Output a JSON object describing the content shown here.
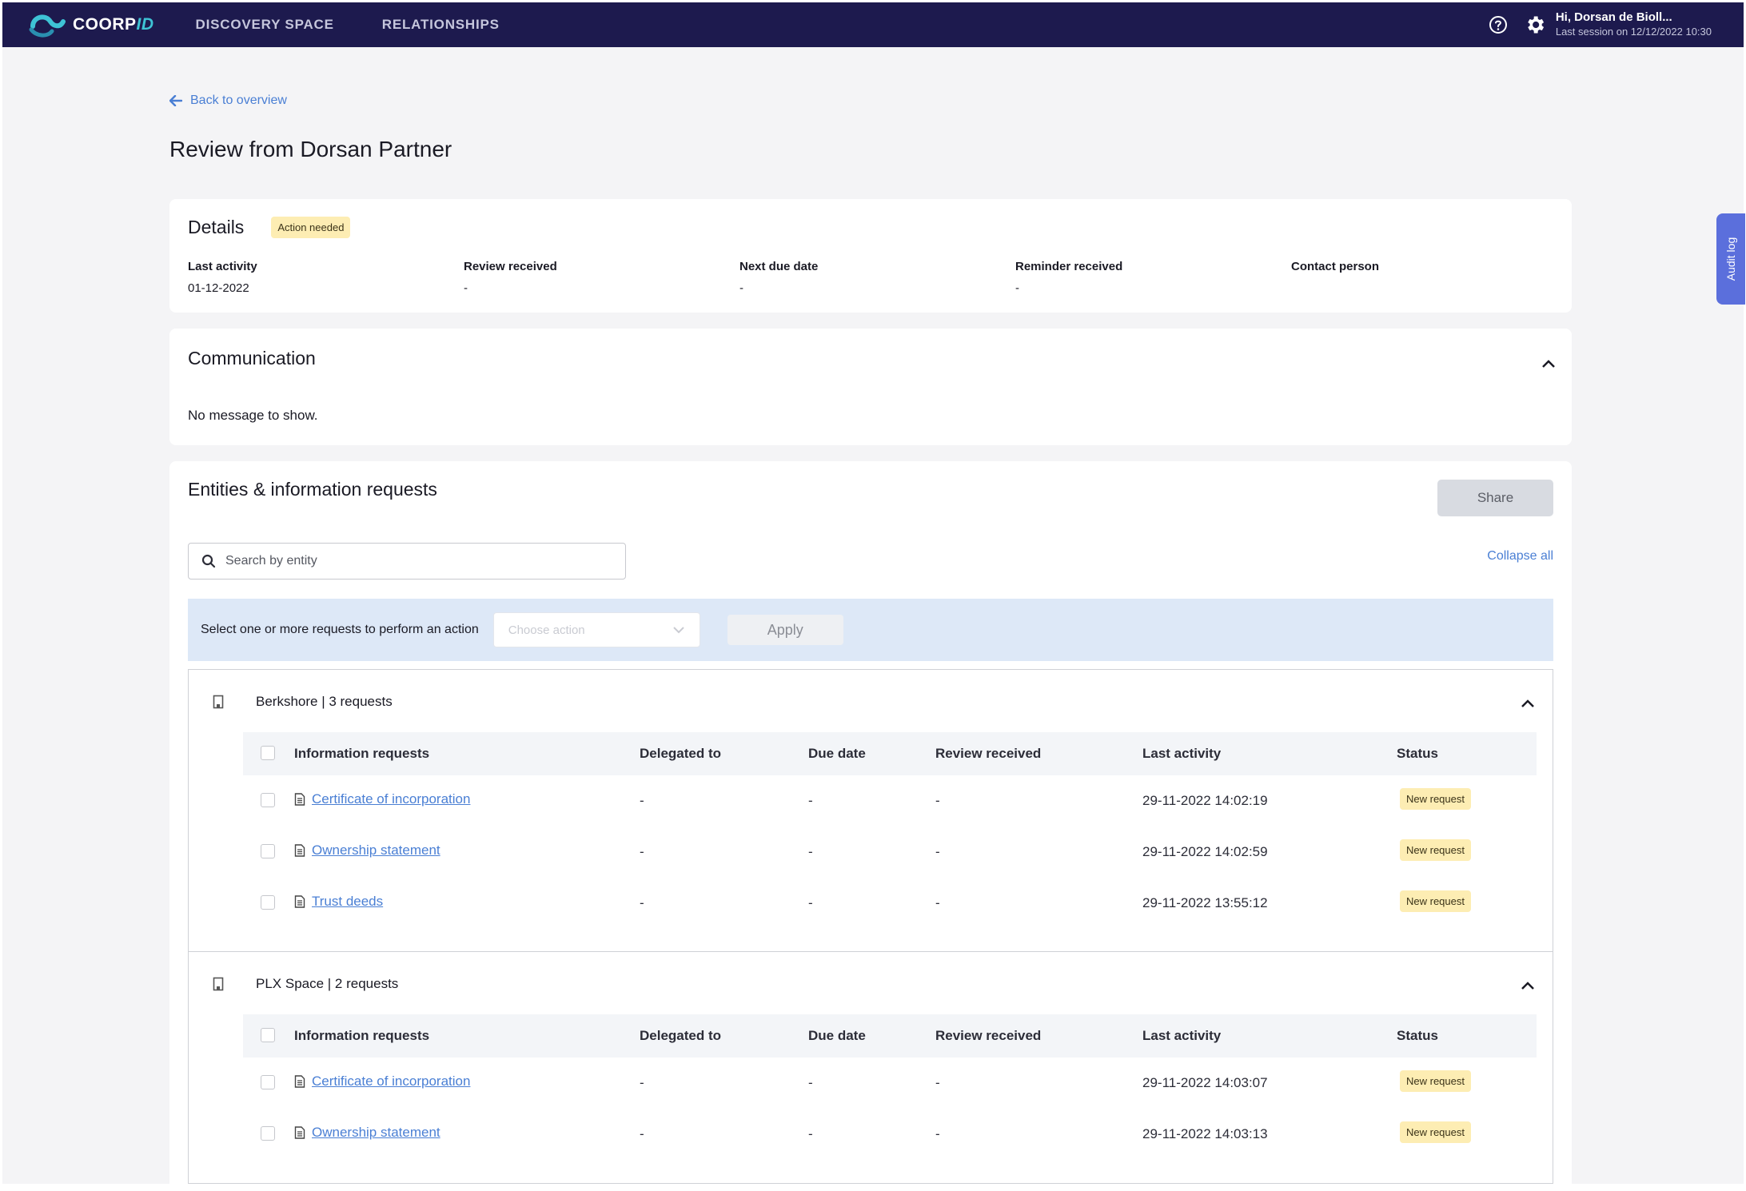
{
  "header": {
    "logo_text": "COORP",
    "logo_text_accent": "ID",
    "nav": [
      "DISCOVERY SPACE",
      "RELATIONSHIPS"
    ],
    "user_greeting": "Hi, Dorsan de Bioll...",
    "last_session": "Last session on  12/12/2022 10:30"
  },
  "back_link": "Back to overview",
  "page_title": "Review from Dorsan Partner",
  "details": {
    "title": "Details",
    "badge": "Action needed",
    "fields": [
      {
        "label": "Last activity",
        "value": "01-12-2022"
      },
      {
        "label": "Review received",
        "value": "-"
      },
      {
        "label": "Next due date",
        "value": "-"
      },
      {
        "label": "Reminder received",
        "value": "-"
      },
      {
        "label": "Contact person",
        "value": ""
      }
    ]
  },
  "communication": {
    "title": "Communication",
    "empty_message": "No message to show."
  },
  "entities": {
    "title": "Entities & information requests",
    "share_label": "Share",
    "search_placeholder": "Search by entity",
    "collapse_all": "Collapse all",
    "action_bar_label": "Select one or more requests to perform an action",
    "choose_action_placeholder": "Choose action",
    "apply_label": "Apply",
    "columns": [
      "Information requests",
      "Delegated to",
      "Due date",
      "Review received",
      "Last activity",
      "Status"
    ],
    "groups": [
      {
        "title": "Berkshore | 3 requests",
        "rows": [
          {
            "name": "Certificate of incorporation",
            "delegated": "-",
            "due": "-",
            "review": "-",
            "last_activity": "29-11-2022 14:02:19",
            "status": "New request"
          },
          {
            "name": "Ownership statement",
            "delegated": "-",
            "due": "-",
            "review": "-",
            "last_activity": "29-11-2022 14:02:59",
            "status": "New request"
          },
          {
            "name": "Trust deeds",
            "delegated": "-",
            "due": "-",
            "review": "-",
            "last_activity": "29-11-2022 13:55:12",
            "status": "New request"
          }
        ]
      },
      {
        "title": "PLX Space | 2 requests",
        "rows": [
          {
            "name": "Certificate of incorporation",
            "delegated": "-",
            "due": "-",
            "review": "-",
            "last_activity": "29-11-2022 14:03:07",
            "status": "New request"
          },
          {
            "name": "Ownership statement",
            "delegated": "-",
            "due": "-",
            "review": "-",
            "last_activity": "29-11-2022 14:03:13",
            "status": "New request"
          }
        ]
      }
    ]
  },
  "audit_log_label": "Audit log",
  "colors": {
    "header_bg": "#1d1a4e",
    "accent": "#4a7fd4",
    "badge_bg": "#fdedb3",
    "action_bar_bg": "#dde8f7",
    "audit_tab": "#5b6fdc"
  }
}
